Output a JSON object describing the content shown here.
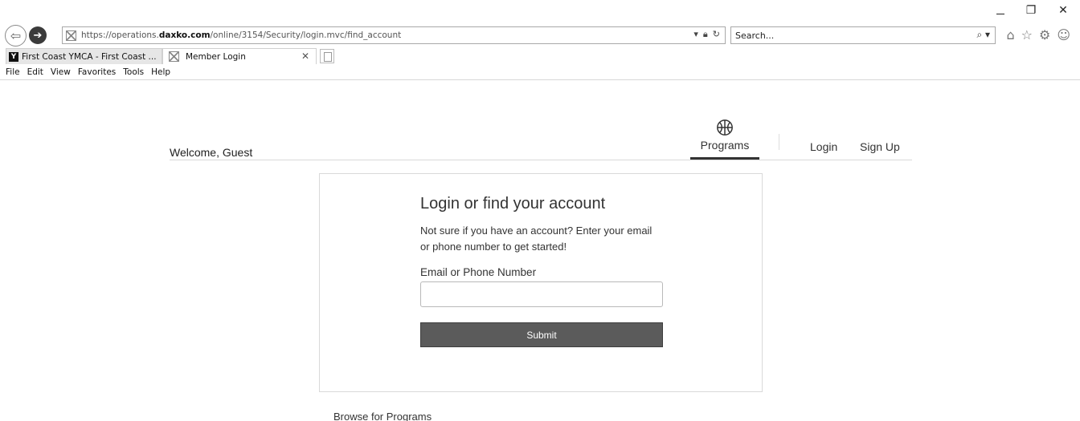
{
  "browser": {
    "url_prefix": "https://operations.",
    "url_domain": "daxko.com",
    "url_path": "/online/3154/Security/login.mvc/find_account",
    "search_placeholder": "Search...",
    "tabs": [
      {
        "label": "First Coast YMCA - First Coast ...",
        "active": false
      },
      {
        "label": "Member Login",
        "active": true
      }
    ],
    "menu": [
      "File",
      "Edit",
      "View",
      "Favorites",
      "Tools",
      "Help"
    ]
  },
  "header": {
    "welcome": "Welcome, Guest",
    "nav": {
      "programs": "Programs",
      "login": "Login",
      "signup": "Sign Up"
    }
  },
  "login": {
    "title": "Login or find your account",
    "description": "Not sure if you have an account? Enter your email or phone number to get started!",
    "field_label": "Email or Phone Number",
    "field_value": "",
    "submit_label": "Submit"
  },
  "footer": {
    "browse_link": "Browse for Programs"
  },
  "colors": {
    "button_bg": "#5b5b5b",
    "active_nav_underline": "#333333"
  }
}
